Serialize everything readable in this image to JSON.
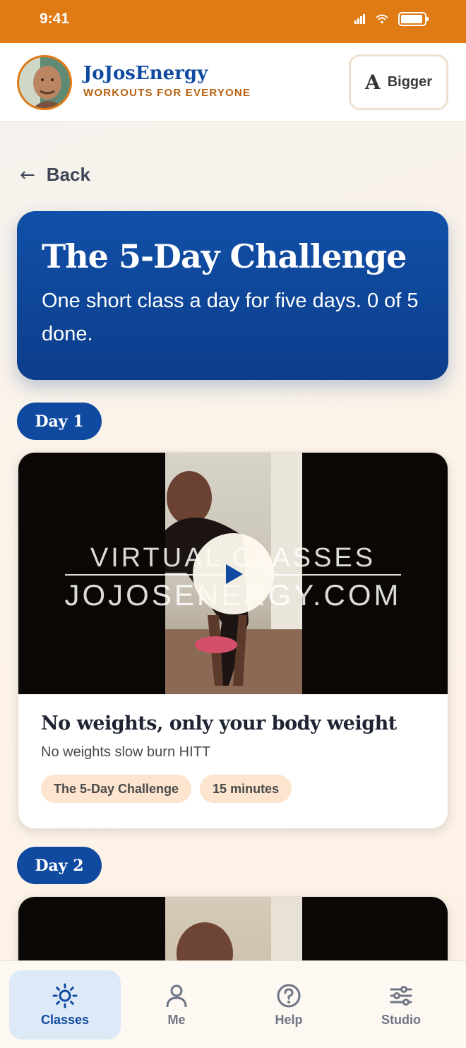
{
  "status_bar": {
    "time": "9:41"
  },
  "header": {
    "brand_name": "JoJosEnergy",
    "brand_tagline": "WORKOUTS FOR EVERYONE",
    "bigger_icon": "A",
    "bigger_label": "Bigger"
  },
  "nav": {
    "back_label": "Back"
  },
  "hero": {
    "title": "The 5-Day Challenge",
    "subtitle": "One short class a day for five days. 0 of 5 done."
  },
  "days": [
    {
      "label": "Day 1",
      "video_overlay_line1": "VIRTUAL CLASSES",
      "video_overlay_line2": "JOJOSENERGY.COM",
      "title": "No weights, only your body weight",
      "subtitle": "No weights slow burn HITT",
      "chips": [
        "The 5-Day Challenge",
        "15 minutes"
      ]
    },
    {
      "label": "Day 2"
    }
  ],
  "bottom_nav": [
    {
      "label": "Classes",
      "icon": "sun-icon",
      "active": true
    },
    {
      "label": "Me",
      "icon": "person-icon",
      "active": false
    },
    {
      "label": "Help",
      "icon": "question-icon",
      "active": false
    },
    {
      "label": "Studio",
      "icon": "sliders-icon",
      "active": false
    }
  ],
  "colors": {
    "accent_orange": "#e07a15",
    "brand_blue": "#0f4aa0",
    "chip_bg": "#fce4cf"
  }
}
